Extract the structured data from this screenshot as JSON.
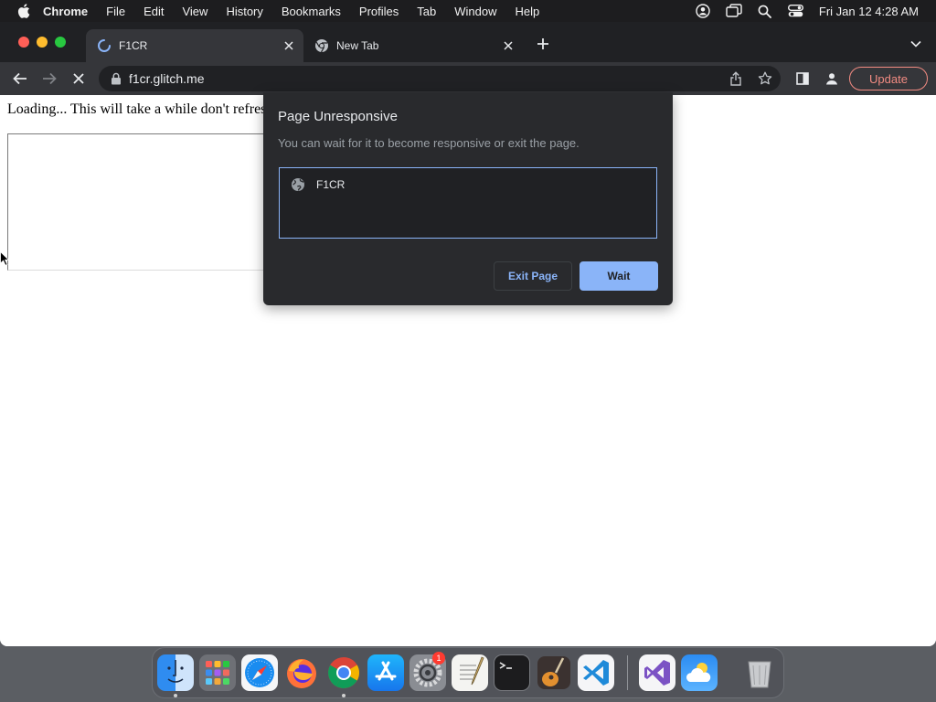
{
  "menubar": {
    "app_name": "Chrome",
    "menus": [
      "File",
      "Edit",
      "View",
      "History",
      "Bookmarks",
      "Profiles",
      "Tab",
      "Window",
      "Help"
    ],
    "clock": "Fri Jan 12  4:28 AM",
    "status_icons": [
      "user-icon",
      "screen-mirroring-icon",
      "spotlight-search-icon",
      "control-center-icon"
    ]
  },
  "tabs": [
    {
      "title": "F1CR",
      "active": true,
      "favicon": "loading-spinner-icon"
    },
    {
      "title": "New Tab",
      "active": false,
      "favicon": "chrome-icon"
    }
  ],
  "toolbar": {
    "url": "f1cr.glitch.me",
    "update_label": "Update"
  },
  "page": {
    "loading_text": "Loading... This will take a while don't refres"
  },
  "dialog": {
    "title": "Page Unresponsive",
    "message": "You can wait for it to become responsive or exit the page.",
    "pages": [
      "F1CR"
    ],
    "exit_label": "Exit Page",
    "wait_label": "Wait"
  },
  "dock": {
    "apps": [
      "finder",
      "launchpad",
      "safari",
      "firefox",
      "chrome",
      "app-store",
      "system-settings",
      "textedit",
      "terminal",
      "garageband",
      "vscode",
      "visual-studio",
      "weather",
      "trash"
    ],
    "settings_badge": "1"
  },
  "colors": {
    "accent": "#8ab4f8",
    "dialog_bg": "#292a2d",
    "update": "#f28b82"
  }
}
